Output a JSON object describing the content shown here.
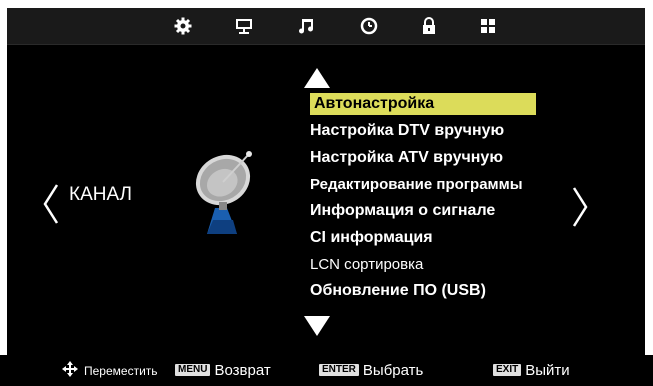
{
  "top_tabs": [
    {
      "name": "settings-gear-icon"
    },
    {
      "name": "monitor-icon"
    },
    {
      "name": "music-note-icon"
    },
    {
      "name": "clock-icon"
    },
    {
      "name": "lock-icon"
    },
    {
      "name": "grid-icon"
    }
  ],
  "category": {
    "label": "КАНАЛ"
  },
  "menu": {
    "items": [
      {
        "label": "Автонастройка",
        "selected": true
      },
      {
        "label": "Настройка DTV вручную"
      },
      {
        "label": "Настройка ATV вручную"
      },
      {
        "label": "Редактирование программы"
      },
      {
        "label": "Информация о сигнале"
      },
      {
        "label": "CI информация"
      },
      {
        "label": "LCN сортировка"
      },
      {
        "label": "Обновление ПО (USB)"
      }
    ]
  },
  "footer": {
    "move_label": "Переместить",
    "menu_key": "MENU",
    "back_label": "Возврат",
    "enter_key": "ENTER",
    "select_label": "Выбрать",
    "exit_key": "EXIT",
    "exit_label": "Выйти"
  },
  "colors": {
    "highlight": "#dcdc5a",
    "background": "#000000",
    "text": "#ffffff"
  }
}
